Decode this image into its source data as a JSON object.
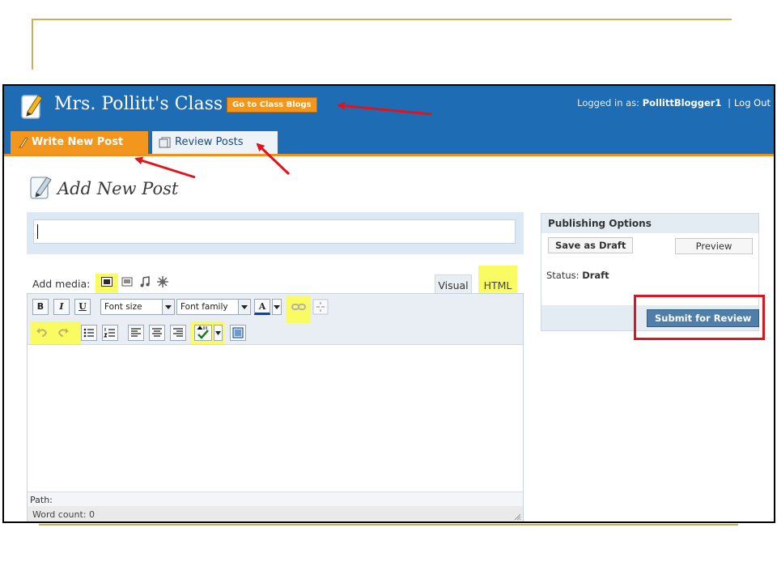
{
  "header": {
    "blog_title": "Mrs. Pollitt's Class",
    "class_blogs_button": "Go to Class Blogs",
    "logged_in_label": "Logged in as:",
    "username": "PollittBlogger1",
    "separator": "|",
    "logout": "Log Out"
  },
  "tabs": {
    "write_new_post": "Write New Post",
    "review_posts": "Review Posts"
  },
  "page": {
    "title": "Add New Post"
  },
  "editor": {
    "title_value": "",
    "add_media_label": "Add media:",
    "tab_visual": "Visual",
    "tab_html": "HTML",
    "toolbar": {
      "bold": "B",
      "italic": "I",
      "underline": "U",
      "font_size": "Font size",
      "font_family": "Font family",
      "text_color": "A"
    },
    "path_label": "Path:",
    "word_count": "Word count: 0"
  },
  "publish": {
    "header": "Publishing Options",
    "save_draft": "Save as Draft",
    "preview": "Preview",
    "status_label": "Status:",
    "status_value": "Draft",
    "submit": "Submit for Review"
  },
  "colors": {
    "header_blue": "#1e6cb3",
    "accent_orange": "#f3961e",
    "highlight_yellow": "#fafb62",
    "annotation_red": "#e0141e",
    "submit_blue": "#4f7ea9"
  }
}
